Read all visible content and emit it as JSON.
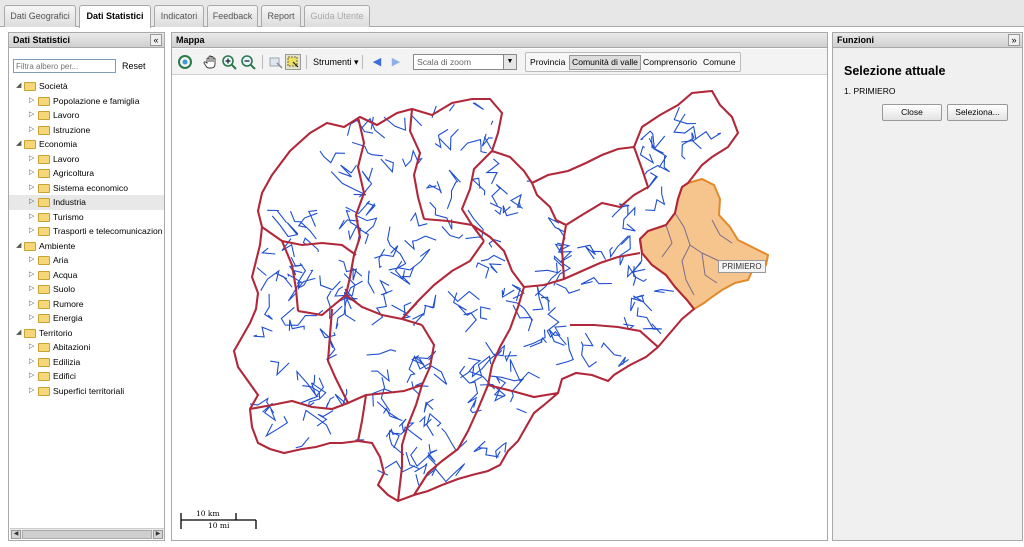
{
  "tabs": [
    {
      "label": "Dati Geografici",
      "state": "normal"
    },
    {
      "label": "Dati Statistici",
      "state": "active"
    },
    {
      "label": "Indicatori",
      "state": "normal"
    },
    {
      "label": "Feedback",
      "state": "normal"
    },
    {
      "label": "Report",
      "state": "normal"
    },
    {
      "label": "Guida Utente",
      "state": "disabled"
    }
  ],
  "left_panel": {
    "title": "Dati Statistici",
    "collapse_icon": "«",
    "filter_placeholder": "Filtra albero per...",
    "reset_label": "Reset",
    "tree": [
      {
        "label": "Società",
        "expanded": true,
        "children": [
          "Popolazione e famiglia",
          "Lavoro",
          "Istruzione"
        ]
      },
      {
        "label": "Economia",
        "expanded": true,
        "children": [
          "Lavoro",
          "Agricoltura",
          "Sistema economico",
          "Industria",
          "Turismo",
          "Trasporti e telecomunicazion"
        ]
      },
      {
        "label": "Ambiente",
        "expanded": true,
        "children": [
          "Aria",
          "Acqua",
          "Suolo",
          "Rumore",
          "Energia"
        ]
      },
      {
        "label": "Territorio",
        "expanded": true,
        "children": [
          "Abitazioni",
          "Edilizia",
          "Edifici",
          "Superfici territoriali"
        ]
      }
    ],
    "selected_item": "Industria"
  },
  "map_panel": {
    "title": "Mappa",
    "toolbar": {
      "strumenti_label": "Strumenti",
      "zoom_scale_placeholder": "Scala di zoom",
      "levels": [
        "Provincia",
        "Comunità di valle",
        "Comprensorio",
        "Comune"
      ],
      "active_level": "Comunità di valle"
    },
    "tooltip": "PRIMIERO",
    "scale_km": "10 km",
    "scale_mi": "10 mi",
    "colors": {
      "district_border": "#b0283a",
      "municipality_border": "#1f4fd0",
      "selected_fill": "#f6c58e",
      "selected_border": "#e08a2a"
    }
  },
  "right_panel": {
    "title": "Funzioni",
    "collapse_icon": "»",
    "selection_title": "Selezione attuale",
    "selection_items": [
      "1. PRIMIERO"
    ],
    "close_label": "Close",
    "select_label": "Seleziona..."
  }
}
